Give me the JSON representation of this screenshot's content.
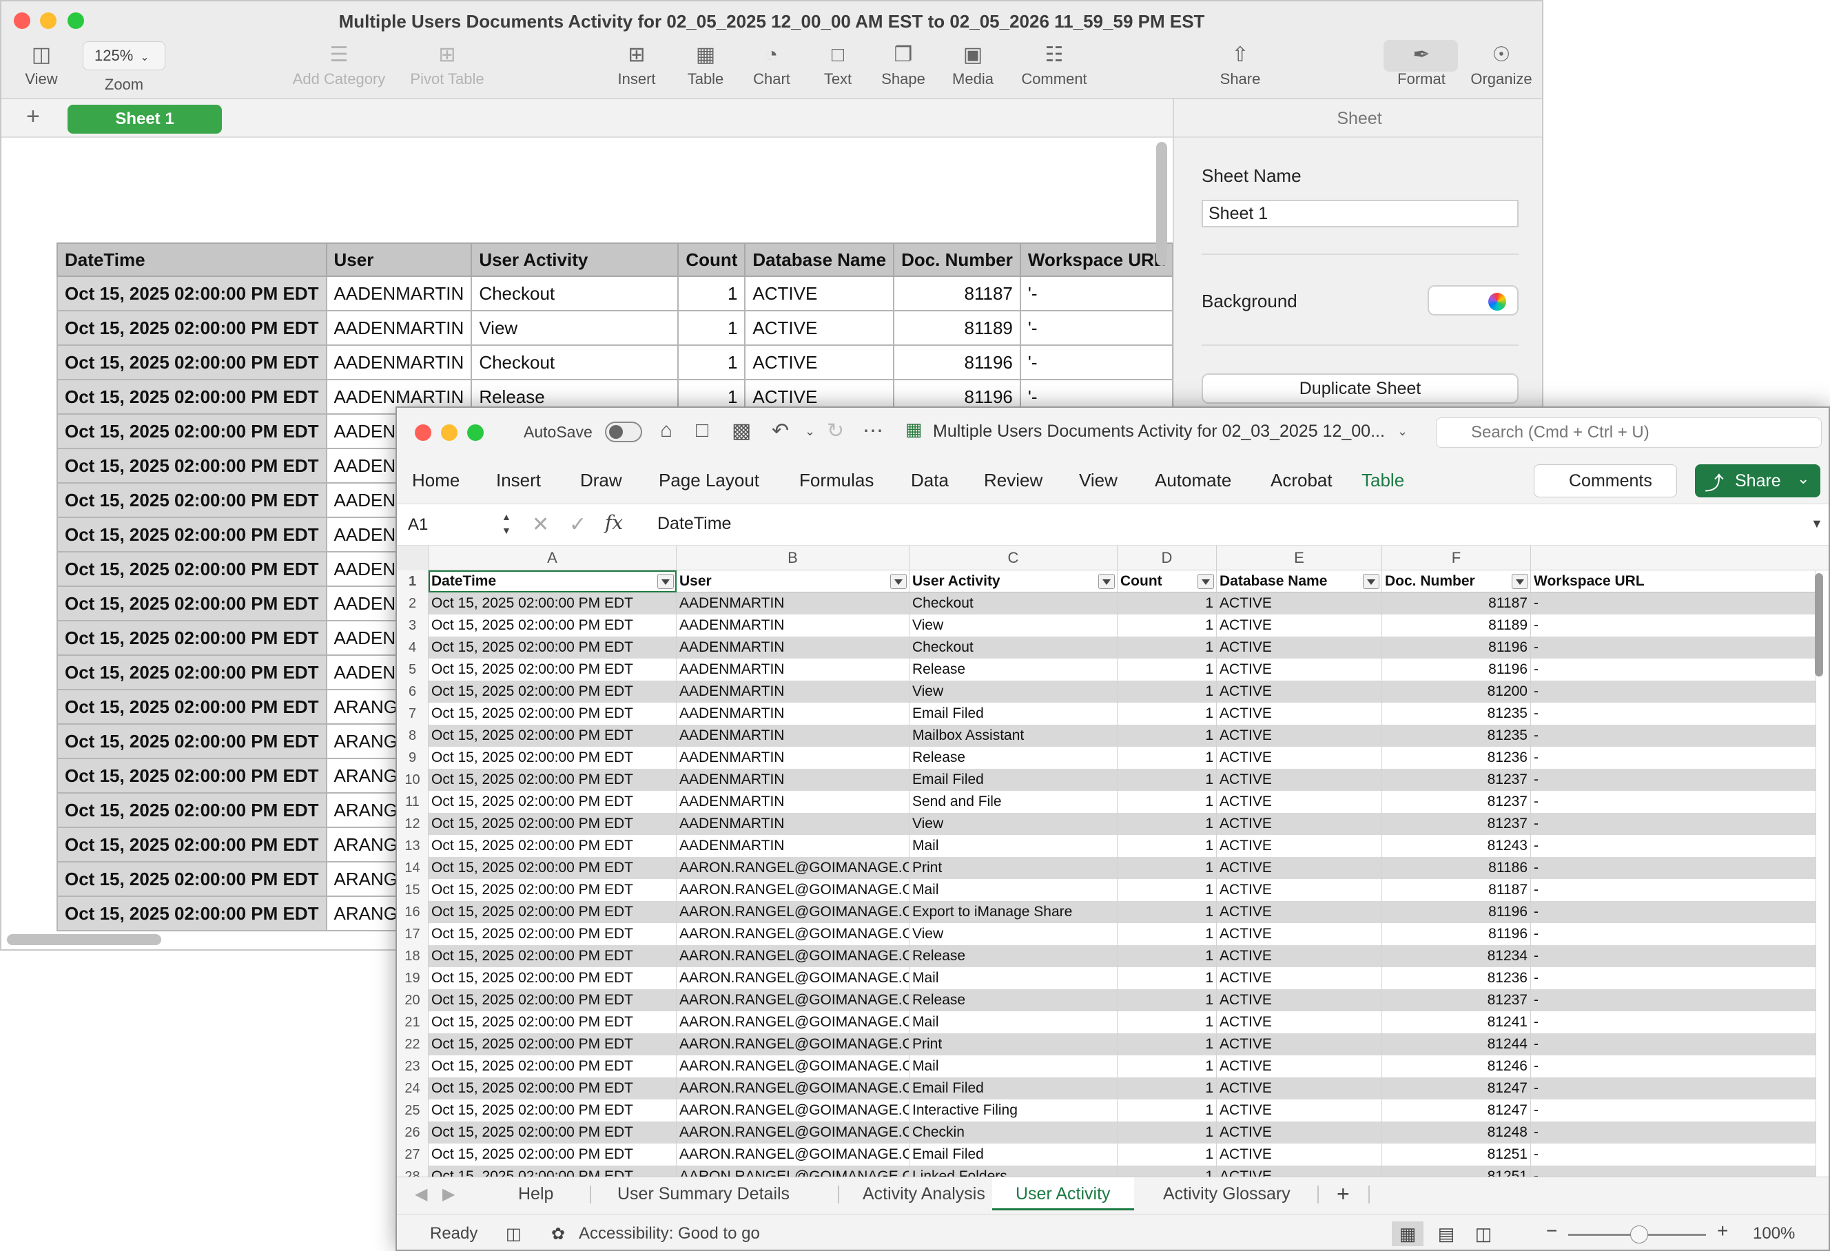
{
  "numbers": {
    "title": "Multiple Users Documents Activity for 02_05_2025 12_00_00 AM EST to 02_05_2026 11_59_59 PM EST",
    "toolbar": {
      "view": "View",
      "zoom_value": "125%",
      "zoom": "Zoom",
      "add_category": "Add Category",
      "pivot_table": "Pivot Table",
      "insert": "Insert",
      "table": "Table",
      "chart": "Chart",
      "text": "Text",
      "shape": "Shape",
      "media": "Media",
      "comment": "Comment",
      "share": "Share",
      "format": "Format",
      "organize": "Organize"
    },
    "sheet_tab": "Sheet 1",
    "inspector": {
      "header": "Sheet",
      "sheet_name_label": "Sheet Name",
      "sheet_name_value": "Sheet 1",
      "background_label": "Background",
      "duplicate_button": "Duplicate Sheet"
    },
    "table": {
      "headers": [
        "DateTime",
        "User",
        "User Activity",
        "Count",
        "Database Name",
        "Doc. Number",
        "Workspace URL"
      ],
      "rows": [
        [
          "Oct 15, 2025 02:00:00 PM EDT",
          "AADENMARTIN",
          "Checkout",
          "1",
          "ACTIVE",
          "81187",
          "'-"
        ],
        [
          "Oct 15, 2025 02:00:00 PM EDT",
          "AADENMARTIN",
          "View",
          "1",
          "ACTIVE",
          "81189",
          "'-"
        ],
        [
          "Oct 15, 2025 02:00:00 PM EDT",
          "AADENMARTIN",
          "Checkout",
          "1",
          "ACTIVE",
          "81196",
          "'-"
        ],
        [
          "Oct 15, 2025 02:00:00 PM EDT",
          "AADENMARTIN",
          "Release",
          "1",
          "ACTIVE",
          "81196",
          "'-"
        ],
        [
          "Oct 15, 2025 02:00:00 PM EDT",
          "AADENM"
        ],
        [
          "Oct 15, 2025 02:00:00 PM EDT",
          "AADENM"
        ],
        [
          "Oct 15, 2025 02:00:00 PM EDT",
          "AADENM"
        ],
        [
          "Oct 15, 2025 02:00:00 PM EDT",
          "AADENM"
        ],
        [
          "Oct 15, 2025 02:00:00 PM EDT",
          "AADENM"
        ],
        [
          "Oct 15, 2025 02:00:00 PM EDT",
          "AADENM"
        ],
        [
          "Oct 15, 2025 02:00:00 PM EDT",
          "AADENM"
        ],
        [
          "Oct 15, 2025 02:00:00 PM EDT",
          "AADENM"
        ],
        [
          "Oct 15, 2025 02:00:00 PM EDT",
          "ARANGE"
        ],
        [
          "Oct 15, 2025 02:00:00 PM EDT",
          "ARANGE"
        ],
        [
          "Oct 15, 2025 02:00:00 PM EDT",
          "ARANGE"
        ],
        [
          "Oct 15, 2025 02:00:00 PM EDT",
          "ARANGE"
        ],
        [
          "Oct 15, 2025 02:00:00 PM EDT",
          "ARANGE"
        ],
        [
          "Oct 15, 2025 02:00:00 PM EDT",
          "ARANGE"
        ],
        [
          "Oct 15, 2025 02:00:00 PM EDT",
          "ARANGE"
        ]
      ]
    }
  },
  "excel": {
    "autosave_label": "AutoSave",
    "doc_title": "Multiple Users Documents Activity for 02_03_2025 12_00...",
    "search_placeholder": "Search (Cmd + Ctrl + U)",
    "tabs": [
      "Home",
      "Insert",
      "Draw",
      "Page Layout",
      "Formulas",
      "Data",
      "Review",
      "View",
      "Automate",
      "Acrobat",
      "Table"
    ],
    "active_tab": "Table",
    "comments_button": "Comments",
    "share_button": "Share",
    "name_box": "A1",
    "formula_value": "DateTime",
    "column_letters": [
      "A",
      "B",
      "C",
      "D",
      "E",
      "F"
    ],
    "headers": [
      "DateTime",
      "User",
      "User Activity",
      "Count",
      "Database Name",
      "Doc. Number",
      "Workspace URL"
    ],
    "rows": [
      [
        "Oct 15, 2025 02:00:00 PM EDT",
        "AADENMARTIN",
        "Checkout",
        "1",
        "ACTIVE",
        "81187",
        "-"
      ],
      [
        "Oct 15, 2025 02:00:00 PM EDT",
        "AADENMARTIN",
        "View",
        "1",
        "ACTIVE",
        "81189",
        "-"
      ],
      [
        "Oct 15, 2025 02:00:00 PM EDT",
        "AADENMARTIN",
        "Checkout",
        "1",
        "ACTIVE",
        "81196",
        "-"
      ],
      [
        "Oct 15, 2025 02:00:00 PM EDT",
        "AADENMARTIN",
        "Release",
        "1",
        "ACTIVE",
        "81196",
        "-"
      ],
      [
        "Oct 15, 2025 02:00:00 PM EDT",
        "AADENMARTIN",
        "View",
        "1",
        "ACTIVE",
        "81200",
        "-"
      ],
      [
        "Oct 15, 2025 02:00:00 PM EDT",
        "AADENMARTIN",
        "Email Filed",
        "1",
        "ACTIVE",
        "81235",
        "-"
      ],
      [
        "Oct 15, 2025 02:00:00 PM EDT",
        "AADENMARTIN",
        "Mailbox Assistant",
        "1",
        "ACTIVE",
        "81235",
        "-"
      ],
      [
        "Oct 15, 2025 02:00:00 PM EDT",
        "AADENMARTIN",
        "Release",
        "1",
        "ACTIVE",
        "81236",
        "-"
      ],
      [
        "Oct 15, 2025 02:00:00 PM EDT",
        "AADENMARTIN",
        "Email Filed",
        "1",
        "ACTIVE",
        "81237",
        "-"
      ],
      [
        "Oct 15, 2025 02:00:00 PM EDT",
        "AADENMARTIN",
        "Send and File",
        "1",
        "ACTIVE",
        "81237",
        "-"
      ],
      [
        "Oct 15, 2025 02:00:00 PM EDT",
        "AADENMARTIN",
        "View",
        "1",
        "ACTIVE",
        "81237",
        "-"
      ],
      [
        "Oct 15, 2025 02:00:00 PM EDT",
        "AADENMARTIN",
        "Mail",
        "1",
        "ACTIVE",
        "81243",
        "-"
      ],
      [
        "Oct 15, 2025 02:00:00 PM EDT",
        "AARON.RANGEL@GOIMANAGE.CO",
        "Print",
        "1",
        "ACTIVE",
        "81186",
        "-"
      ],
      [
        "Oct 15, 2025 02:00:00 PM EDT",
        "AARON.RANGEL@GOIMANAGE.CO",
        "Mail",
        "1",
        "ACTIVE",
        "81187",
        "-"
      ],
      [
        "Oct 15, 2025 02:00:00 PM EDT",
        "AARON.RANGEL@GOIMANAGE.CO",
        "Export to iManage Share",
        "1",
        "ACTIVE",
        "81196",
        "-"
      ],
      [
        "Oct 15, 2025 02:00:00 PM EDT",
        "AARON.RANGEL@GOIMANAGE.CO",
        "View",
        "1",
        "ACTIVE",
        "81196",
        "-"
      ],
      [
        "Oct 15, 2025 02:00:00 PM EDT",
        "AARON.RANGEL@GOIMANAGE.CO",
        "Release",
        "1",
        "ACTIVE",
        "81234",
        "-"
      ],
      [
        "Oct 15, 2025 02:00:00 PM EDT",
        "AARON.RANGEL@GOIMANAGE.CO",
        "Mail",
        "1",
        "ACTIVE",
        "81236",
        "-"
      ],
      [
        "Oct 15, 2025 02:00:00 PM EDT",
        "AARON.RANGEL@GOIMANAGE.CO",
        "Release",
        "1",
        "ACTIVE",
        "81237",
        "-"
      ],
      [
        "Oct 15, 2025 02:00:00 PM EDT",
        "AARON.RANGEL@GOIMANAGE.CO",
        "Mail",
        "1",
        "ACTIVE",
        "81241",
        "-"
      ],
      [
        "Oct 15, 2025 02:00:00 PM EDT",
        "AARON.RANGEL@GOIMANAGE.CO",
        "Print",
        "1",
        "ACTIVE",
        "81244",
        "-"
      ],
      [
        "Oct 15, 2025 02:00:00 PM EDT",
        "AARON.RANGEL@GOIMANAGE.CO",
        "Mail",
        "1",
        "ACTIVE",
        "81246",
        "-"
      ],
      [
        "Oct 15, 2025 02:00:00 PM EDT",
        "AARON.RANGEL@GOIMANAGE.CO",
        "Email Filed",
        "1",
        "ACTIVE",
        "81247",
        "-"
      ],
      [
        "Oct 15, 2025 02:00:00 PM EDT",
        "AARON.RANGEL@GOIMANAGE.CO",
        "Interactive Filing",
        "1",
        "ACTIVE",
        "81247",
        "-"
      ],
      [
        "Oct 15, 2025 02:00:00 PM EDT",
        "AARON.RANGEL@GOIMANAGE.CO",
        "Checkin",
        "1",
        "ACTIVE",
        "81248",
        "-"
      ],
      [
        "Oct 15, 2025 02:00:00 PM EDT",
        "AARON.RANGEL@GOIMANAGE.CO",
        "Email Filed",
        "1",
        "ACTIVE",
        "81251",
        "-"
      ],
      [
        "Oct 15, 2025 02:00:00 PM EDT",
        "AARON.RANGEL@GOIMANAGE.CO",
        "Linked Folders",
        "1",
        "ACTIVE",
        "81251",
        "-"
      ]
    ],
    "sheet_tabs": [
      "Help",
      "User Summary Details",
      "Activity Analysis",
      "User Activity",
      "Activity Glossary"
    ],
    "active_sheet": "User Activity",
    "status": {
      "ready": "Ready",
      "accessibility": "Accessibility: Good to go",
      "zoom": "100%"
    }
  },
  "colors": {
    "numbers_sheet_tab": "#3aa64a",
    "excel_accent": "#1f7a43",
    "close": "#ff5f57",
    "minimize": "#febc2e",
    "maximize": "#28c840"
  },
  "icons": [
    "sidebar-view-icon",
    "add-category-icon",
    "pivot-table-icon",
    "insert-icon",
    "table-icon",
    "chart-icon",
    "text-icon",
    "shape-icon",
    "media-icon",
    "comment-icon",
    "share-icon",
    "format-brush-icon",
    "organize-icon",
    "home-icon",
    "save-icon",
    "undo-icon",
    "redo-icon",
    "search-icon",
    "filter-dropdown-icon"
  ]
}
